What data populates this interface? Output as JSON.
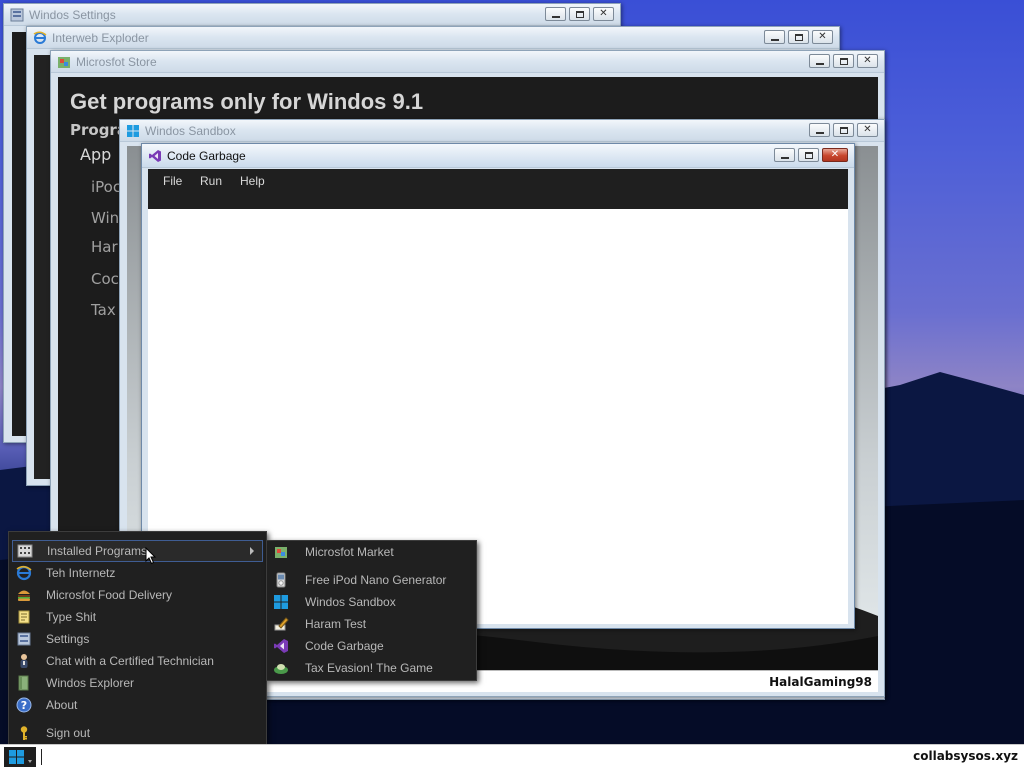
{
  "windows": {
    "settings": {
      "title": "Windos Settings"
    },
    "explorer": {
      "title": "Interweb Exploder"
    },
    "store": {
      "title": "Microsfot Store",
      "heading": "Get programs only for Windos 9.1",
      "subheading": "Progra",
      "section": "App",
      "items": [
        "iPoc",
        "Win",
        "Har",
        "Coc",
        "Tax"
      ]
    },
    "sandbox": {
      "title": "Windos Sandbox",
      "username": "HalalGaming98"
    },
    "code_garbage": {
      "title": "Code Garbage",
      "menu": [
        "File",
        "Run",
        "Help"
      ]
    }
  },
  "start_menu": {
    "items": [
      {
        "label": "Installed Programs",
        "icon": "programs-icon"
      },
      {
        "label": "Teh Internetz",
        "icon": "internet-icon"
      },
      {
        "label": "Microsfot Food Delivery",
        "icon": "burger-icon"
      },
      {
        "label": "Type Shit",
        "icon": "notepad-icon"
      },
      {
        "label": "Settings",
        "icon": "settings-icon"
      },
      {
        "label": "Chat with a Certified Technician",
        "icon": "technician-icon"
      },
      {
        "label": "Windos Explorer",
        "icon": "folder-icon"
      },
      {
        "label": "About",
        "icon": "help-icon"
      },
      {
        "label": "Sign out",
        "icon": "key-icon"
      }
    ]
  },
  "installed_programs": {
    "items": [
      {
        "label": "Microsfot Market",
        "icon": "store-icon"
      },
      {
        "label": "Free iPod Nano Generator",
        "icon": "ipod-icon"
      },
      {
        "label": "Windos Sandbox",
        "icon": "windows-logo-icon"
      },
      {
        "label": "Haram Test",
        "icon": "pencil-icon"
      },
      {
        "label": "Code Garbage",
        "icon": "visual-studio-icon"
      },
      {
        "label": "Tax Evasion! The Game",
        "icon": "game-icon"
      }
    ]
  },
  "taskbar": {
    "tray_text": "collabsysos.xyz"
  },
  "colors": {
    "accent": "#0078d7",
    "menu_bg": "#202020",
    "highlight_border": "#3f5d93"
  }
}
